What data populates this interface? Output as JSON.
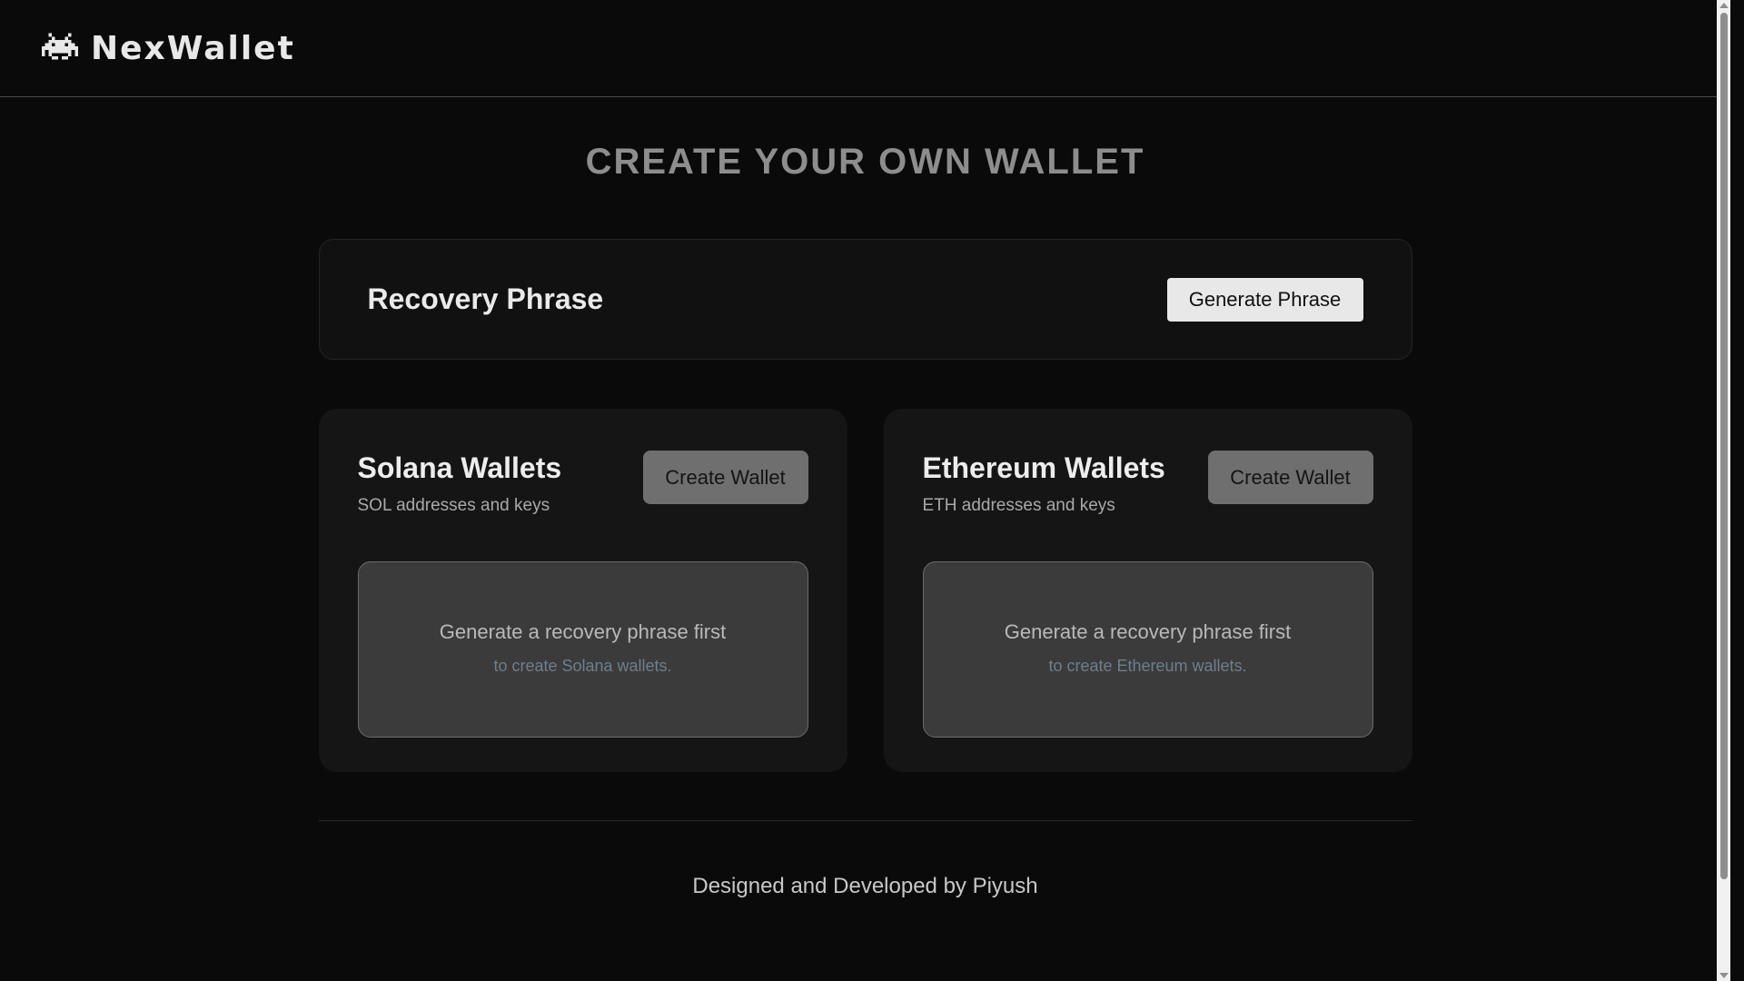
{
  "header": {
    "brand": "NexWallet",
    "logo_icon": "space-invader-icon"
  },
  "main": {
    "title": "CREATE YOUR OWN WALLET",
    "recovery": {
      "title": "Recovery Phrase",
      "button_label": "Generate Phrase"
    },
    "wallets": [
      {
        "title": "Solana Wallets",
        "subtitle": "SOL addresses and keys",
        "button_label": "Create Wallet",
        "empty_main": "Generate a recovery phrase first",
        "empty_hint": "to create Solana wallets."
      },
      {
        "title": "Ethereum Wallets",
        "subtitle": "ETH addresses and keys",
        "button_label": "Create Wallet",
        "empty_main": "Generate a recovery phrase first",
        "empty_hint": "to create Ethereum wallets."
      }
    ]
  },
  "footer": {
    "credit": "Designed and Developed by Piyush"
  },
  "colors": {
    "background": "#0a0a0a",
    "card": "#151515",
    "primary_button": "#e8e8e8",
    "secondary_button": "#6f6f6f"
  }
}
